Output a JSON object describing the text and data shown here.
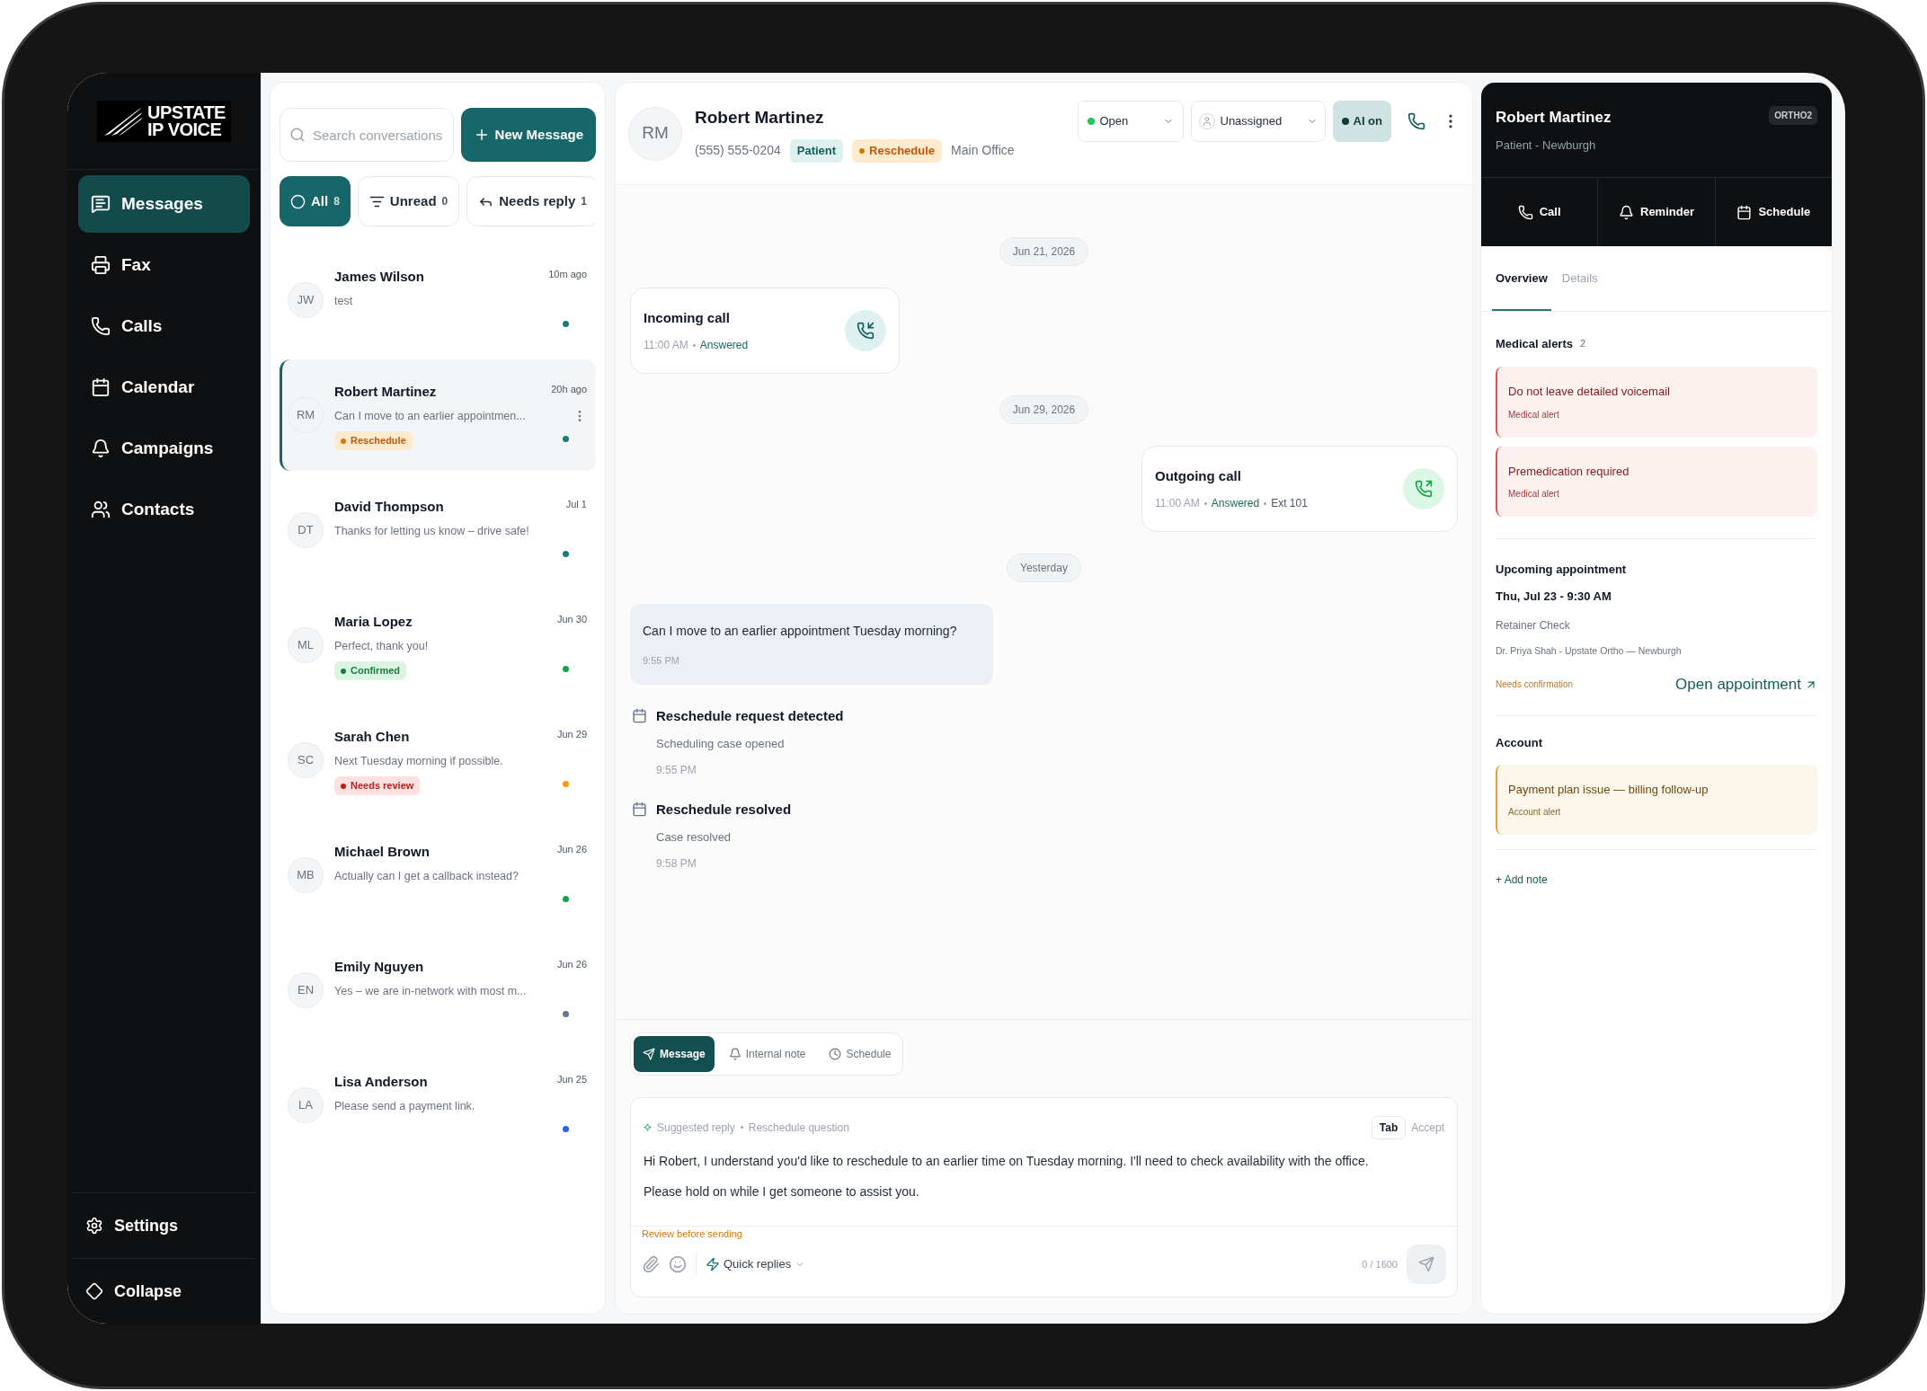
{
  "brand": {
    "line1": "UPSTATE",
    "line2": "IP VOICE"
  },
  "nav": [
    {
      "label": "Messages",
      "selected": true
    },
    {
      "label": "Fax",
      "selected": false
    },
    {
      "label": "Calls",
      "selected": false
    },
    {
      "label": "Calendar",
      "selected": false
    },
    {
      "label": "Campaigns",
      "selected": false
    },
    {
      "label": "Contacts",
      "selected": false
    }
  ],
  "nav_bottom": [
    "Settings",
    "Collapse"
  ],
  "conversations": {
    "search": {
      "placeholder": "Search conversations"
    },
    "new_button": "New Message",
    "filters": [
      {
        "label": "All",
        "count": "8",
        "selected": true
      },
      {
        "label": "Unread",
        "count": "0",
        "selected": false
      },
      {
        "label": "Needs reply",
        "count": "1",
        "selected": false
      }
    ],
    "items": [
      {
        "initials": "JW",
        "name": "James Wilson",
        "time": "10m ago",
        "preview": "test",
        "selected": false,
        "color": "#1d7a78"
      },
      {
        "initials": "RM",
        "name": "Robert Martinez",
        "time": "20h ago",
        "preview": "Can I move to an earlier appointmen...",
        "tag": {
          "label": "Reschedule",
          "kind": "reschedule"
        },
        "selected": true,
        "color": "#1d7a78"
      },
      {
        "initials": "DT",
        "name": "David Thompson",
        "time": "Jul 1",
        "preview": "Thanks for letting us know – drive safe!",
        "selected": false,
        "color": "#1d7a78"
      },
      {
        "initials": "ML",
        "name": "Maria Lopez",
        "time": "Jun 30",
        "preview": "Perfect, thank you!",
        "tag": {
          "label": "Confirmed",
          "kind": "confirmed"
        },
        "selected": false,
        "color": "#16a34a"
      },
      {
        "initials": "SC",
        "name": "Sarah Chen",
        "time": "Jun 29",
        "preview": "Next Tuesday morning if possible.",
        "tag": {
          "label": "Needs review",
          "kind": "review"
        },
        "selected": false,
        "color": "#f59e0b"
      },
      {
        "initials": "MB",
        "name": "Michael Brown",
        "time": "Jun 26",
        "preview": "Actually can I get a callback instead?",
        "selected": false,
        "color": "#16a34a"
      },
      {
        "initials": "EN",
        "name": "Emily Nguyen",
        "time": "Jun 26",
        "preview": "Yes – we are in-network with most m...",
        "selected": false,
        "color": "#64748b"
      },
      {
        "initials": "LA",
        "name": "Lisa Anderson",
        "time": "Jun 25",
        "preview": "Please send a payment link.",
        "selected": false,
        "color": "#2563eb"
      }
    ]
  },
  "chat": {
    "initials": "RM",
    "name": "Robert Martinez",
    "phone": "(555) 555-0204",
    "tags": [
      {
        "label": "Patient",
        "kind": "patient"
      },
      {
        "label": "Reschedule",
        "kind": "reschedule"
      }
    ],
    "location": "Main Office",
    "status": {
      "label": "Open",
      "color": "#22c55e"
    },
    "assignee": "Unassigned",
    "ai": {
      "label": "AI on",
      "on": true
    },
    "timeline": [
      {
        "kind": "date",
        "label": "Jun 21, 2026"
      },
      {
        "kind": "incoming_call",
        "title": "Incoming call",
        "time": "11:00 AM",
        "status": "Answered"
      },
      {
        "kind": "date",
        "label": "Jun 29, 2026"
      },
      {
        "kind": "outgoing_call",
        "title": "Outgoing call",
        "time": "11:00 AM",
        "status": "Answered",
        "ext": "Ext 101"
      },
      {
        "kind": "date",
        "label": "Yesterday"
      },
      {
        "kind": "message",
        "text": "Can I move to an earlier appointment Tuesday morning?",
        "time": "9:55 PM"
      },
      {
        "kind": "event",
        "title": "Reschedule request detected",
        "subtitle": "Scheduling case opened",
        "time": "9:55 PM"
      },
      {
        "kind": "event",
        "title": "Reschedule resolved",
        "subtitle": "Case resolved",
        "time": "9:58 PM"
      }
    ],
    "composer": {
      "modes": [
        {
          "label": "Message",
          "selected": true
        },
        {
          "label": "Internal note",
          "selected": false
        },
        {
          "label": "Schedule",
          "selected": false
        }
      ],
      "suggestion_label": "Suggested reply",
      "suggestion_topic": "Reschedule question",
      "key": "Tab",
      "action": "Accept",
      "paragraphs": [
        "Hi Robert, I understand you'd like to reschedule to an earlier time on Tuesday morning. I'll need to check availability with the office.",
        "Please hold on while I get someone to assist you."
      ],
      "warning": "Review before sending",
      "quick_replies": "Quick replies",
      "counter": "0 / 1600"
    }
  },
  "contact": {
    "name": "Robert Martinez",
    "subtitle": "Patient - Newburgh",
    "badge": "ORTHO2",
    "actions": [
      "Call",
      "Reminder",
      "Schedule"
    ],
    "tabs": [
      {
        "label": "Overview",
        "selected": true
      },
      {
        "label": "Details",
        "selected": false
      }
    ],
    "medical_alerts": {
      "title": "Medical alerts",
      "count": "2",
      "items": [
        {
          "title": "Do not leave detailed voicemail",
          "label": "Medical alert"
        },
        {
          "title": "Premedication required",
          "label": "Medical alert"
        }
      ]
    },
    "appointment": {
      "heading": "Upcoming appointment",
      "when": "Thu, Jul 23 - 9:30 AM",
      "type": "Retainer Check",
      "provider": "Dr. Priya Shah - Upstate Ortho — Newburgh",
      "status": "Needs confirmation",
      "link": "Open appointment"
    },
    "account": {
      "title": "Account",
      "items": [
        {
          "title": "Payment plan issue — billing follow-up",
          "label": "Account alert"
        }
      ]
    },
    "add_note": "+ Add note"
  }
}
